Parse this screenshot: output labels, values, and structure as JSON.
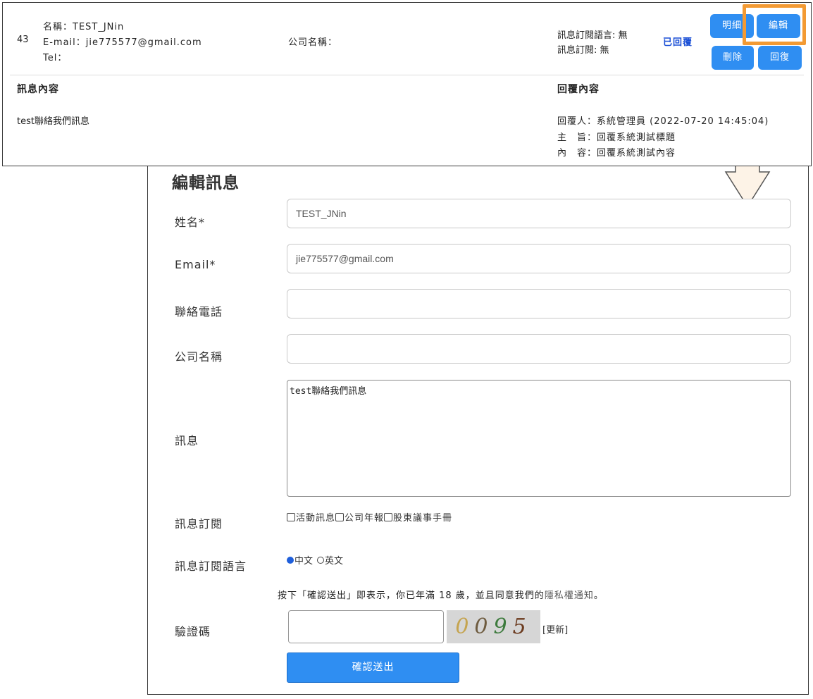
{
  "message_row": {
    "index": "43",
    "name_line": "名稱：TEST_JNin",
    "email_line": "E-mail：jie775577@gmail.com",
    "tel_line": "Tel：",
    "company_line": "公司名稱：",
    "lang_line": "訊息訂閱語言: 無",
    "sub_line": "訊息訂閱: 無",
    "status": "已回覆",
    "buttons": {
      "detail": "明細",
      "edit": "編輯",
      "delete": "刪除",
      "reply": "回復"
    },
    "content_title": "訊息內容",
    "content": "test聯絡我們訊息",
    "reply_title": "回覆內容",
    "reply_by": "回覆人：系統管理員 (2022-07-20 14:45:04)",
    "reply_subject": "主　旨：回覆系統測試標題",
    "reply_content": "內　容：回覆系統測試內容"
  },
  "edit_form": {
    "title": "編輯訊息",
    "labels": {
      "name": "姓名*",
      "email": "Email*",
      "phone": "聯絡電話",
      "company": "公司名稱",
      "message": "訊息",
      "subscription": "訊息訂閱",
      "subscription_lang": "訊息訂閱語言",
      "captcha": "驗證碼"
    },
    "values": {
      "name": "TEST_JNin",
      "email": "jie775577@gmail.com",
      "phone": "",
      "company": "",
      "message": "test聯絡我們訊息",
      "captcha": ""
    },
    "subscription_options": [
      "活動訊息",
      "公司年報",
      "股東議事手冊"
    ],
    "language_options": [
      "中文",
      "英文"
    ],
    "selected_language": "中文",
    "consent_prefix": "按下「確認送出」即表示，你已年滿 18 歲，並且同意我們的",
    "consent_link": "隱私權通知",
    "consent_suffix": "。",
    "captcha_digits": [
      "0",
      "0",
      "9",
      "5"
    ],
    "refresh_label": "[更新]",
    "submit_label": "確認送出"
  },
  "colors": {
    "accent": "#2f8ef2",
    "highlight": "#f39a33",
    "status": "#1a4fd6",
    "captcha_bg": "#d6d6d6"
  }
}
